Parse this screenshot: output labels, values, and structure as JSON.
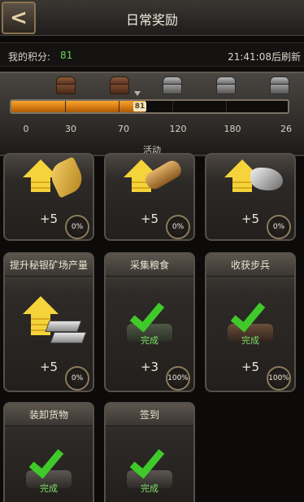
{
  "header": {
    "back_icon": "arrow-left-icon",
    "title": "日常奖励"
  },
  "points": {
    "label": "我的积分:",
    "value": "81",
    "refresh_text": "21:41:08后刷新"
  },
  "progress": {
    "current_points": 81,
    "badge_text": "81",
    "milestones": [
      {
        "label": "0"
      },
      {
        "label": "30",
        "chest": "bronze"
      },
      {
        "label": "70",
        "chest": "bronze"
      },
      {
        "label": "120",
        "chest": "silver"
      },
      {
        "label": "180",
        "chest": "silver"
      },
      {
        "label": "26",
        "chest": "silver"
      }
    ],
    "section_label": "活动",
    "colors": {
      "fill": "#f5a531",
      "done": "#3fca2a"
    }
  },
  "tasks": [
    {
      "title": "",
      "icon": "feather-icon",
      "qty": "+5",
      "pct": "0%"
    },
    {
      "title": "",
      "icon": "wood-log-icon",
      "qty": "+5",
      "pct": "0%"
    },
    {
      "title": "",
      "icon": "ore-icon",
      "qty": "+5",
      "pct": "0%"
    },
    {
      "title": "提升秘银矿场产量",
      "icon": "upgrade-silver-icon",
      "qty": "+5",
      "pct": "0%"
    },
    {
      "title": "采集粮食",
      "icon": "completed-check-icon",
      "done_label": "完成",
      "qty": "+3",
      "pct": "100%"
    },
    {
      "title": "收获步兵",
      "icon": "completed-check-icon",
      "done_label": "完成",
      "qty": "+5",
      "pct": "100%"
    },
    {
      "title": "装卸货物",
      "icon": "completed-check-icon",
      "done_label": "完成"
    },
    {
      "title": "签到",
      "icon": "completed-check-icon",
      "done_label": "完成"
    }
  ]
}
